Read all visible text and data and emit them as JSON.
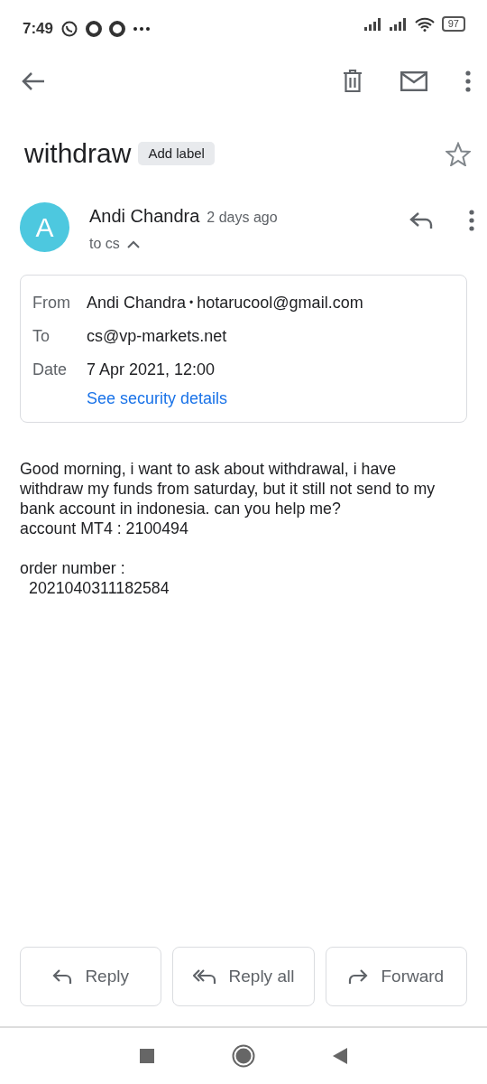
{
  "status_bar": {
    "time": "7:49",
    "battery": "97"
  },
  "subject": {
    "title": "withdraw",
    "label_button": "Add label",
    "starred": false
  },
  "message": {
    "sender": "Andi Chandra",
    "avatar_letter": "A",
    "time": "2 days ago",
    "recipients": "to cs",
    "expanded": true,
    "details": [
      {
        "label": "From",
        "value": "Andi Chandra",
        "separator": "•",
        "extra": "hotarucool@gmail.com"
      },
      {
        "label": "To",
        "value": "cs@vp-markets.net"
      },
      {
        "label": "Date",
        "value": "7 Apr 2021, 12:00"
      }
    ],
    "security_link": "See security details",
    "body": [
      [
        {
          "text": "Good morning, i want to ask about withdrawal, i have withdraw my funds from saturday, but it still not send to my bank account in indonesia. can you help me?",
          "indented": false
        },
        {
          "text": "account MT4 : 2100494",
          "indented": false
        }
      ],
      [
        {
          "text": "order number :",
          "indented": false
        },
        {
          "text": "2021040311182584",
          "indented": true
        }
      ]
    ]
  },
  "actions": [
    {
      "kind": "reply",
      "label": "Reply"
    },
    {
      "kind": "reply_all",
      "label": "Reply all"
    },
    {
      "kind": "forward",
      "label": "Forward"
    }
  ]
}
